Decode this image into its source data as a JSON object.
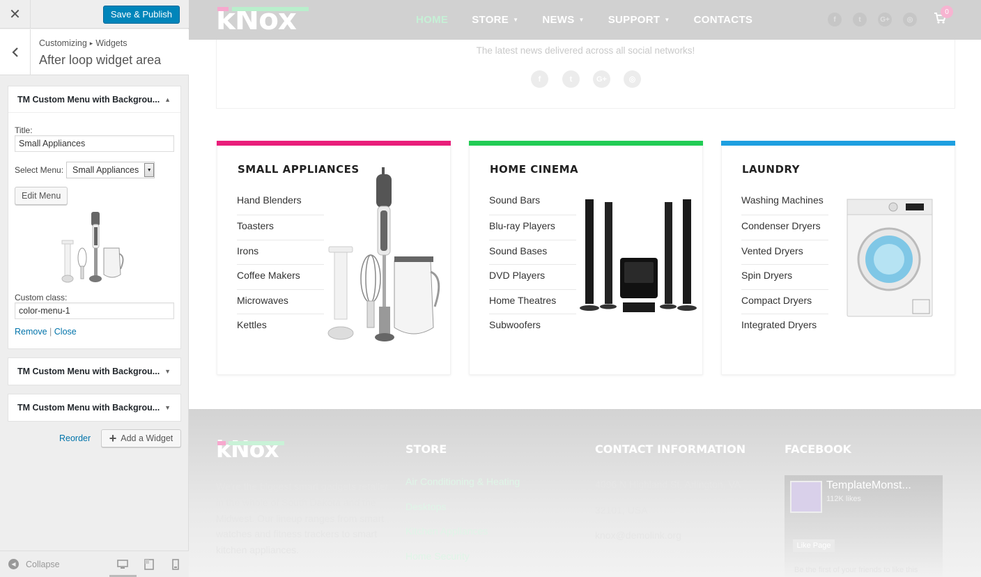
{
  "customizer": {
    "publish_label": "Save & Publish",
    "breadcrumb": [
      "Customizing",
      "Widgets"
    ],
    "section_title": "After loop widget area",
    "widgets": [
      {
        "title": "TM Custom Menu with Backgrou...",
        "expanded": true,
        "title_label": "Title:",
        "title_value": "Small Appliances",
        "select_label": "Select Menu:",
        "select_value": "Small Appliances",
        "edit_menu_label": "Edit Menu",
        "custom_class_label": "Custom class:",
        "custom_class_value": "color-menu-1",
        "remove_label": "Remove",
        "link_separator": "|",
        "close_label": "Close"
      },
      {
        "title": "TM Custom Menu with Backgrou...",
        "expanded": false
      },
      {
        "title": "TM Custom Menu with Backgrou...",
        "expanded": false
      }
    ],
    "reorder_label": "Reorder",
    "add_widget_label": "Add a Widget",
    "collapse_label": "Collapse",
    "devices": [
      "desktop-icon",
      "tablet-icon",
      "mobile-icon"
    ]
  },
  "site": {
    "logo": "kNox",
    "nav": [
      {
        "label": "HOME",
        "active": true,
        "dropdown": false
      },
      {
        "label": "STORE",
        "active": false,
        "dropdown": true
      },
      {
        "label": "NEWS",
        "active": false,
        "dropdown": true
      },
      {
        "label": "SUPPORT",
        "active": false,
        "dropdown": true
      },
      {
        "label": "CONTACTS",
        "active": false,
        "dropdown": false
      }
    ],
    "social": [
      "facebook-icon",
      "twitter-icon",
      "google-plus-icon",
      "instagram-icon"
    ],
    "cart_count": "0",
    "news_text": "The latest news delivered across all social networks!",
    "categories": [
      {
        "title": "SMALL APPLIANCES",
        "color": "#e91e7a",
        "items": [
          "Hand Blenders",
          "Toasters",
          "Irons",
          "Coffee Makers",
          "Microwaves",
          "Kettles"
        ]
      },
      {
        "title": "HOME CINEMA",
        "color": "#22cc55",
        "items": [
          "Sound Bars",
          "Blu-ray Players",
          "Sound Bases",
          "DVD Players",
          "Home Theatres",
          "Subwoofers"
        ]
      },
      {
        "title": "LAUNDRY",
        "color": "#1e9fe0",
        "items": [
          "Washing Machines",
          "Condenser Dryers",
          "Vented Dryers",
          "Spin Dryers",
          "Compact Dryers",
          "Integrated Dryers"
        ]
      }
    ],
    "footer": {
      "description": "We're the biggest smart gadgets retailer in the whole of South Dakota and the Midwest. Our lineup ranges from smart watches and fitness trackers to smart kitchen appliances.",
      "store_heading": "STORE",
      "store_links": [
        "Air Conditioning & Heating",
        "Desktops",
        "Kitchen Appliances",
        "Home Security"
      ],
      "contact_heading": "CONTACT INFORMATION",
      "contact_lines": [
        "4096 N Highland St, Arlington, VA",
        "32101, USA",
        "knox@demolink.org"
      ],
      "facebook_heading": "FACEBOOK",
      "fb_page_name": "TemplateMonst...",
      "fb_likes": "112K likes",
      "fb_like_button": "Like Page",
      "fb_first": "Be the first of your friends to like this"
    }
  }
}
